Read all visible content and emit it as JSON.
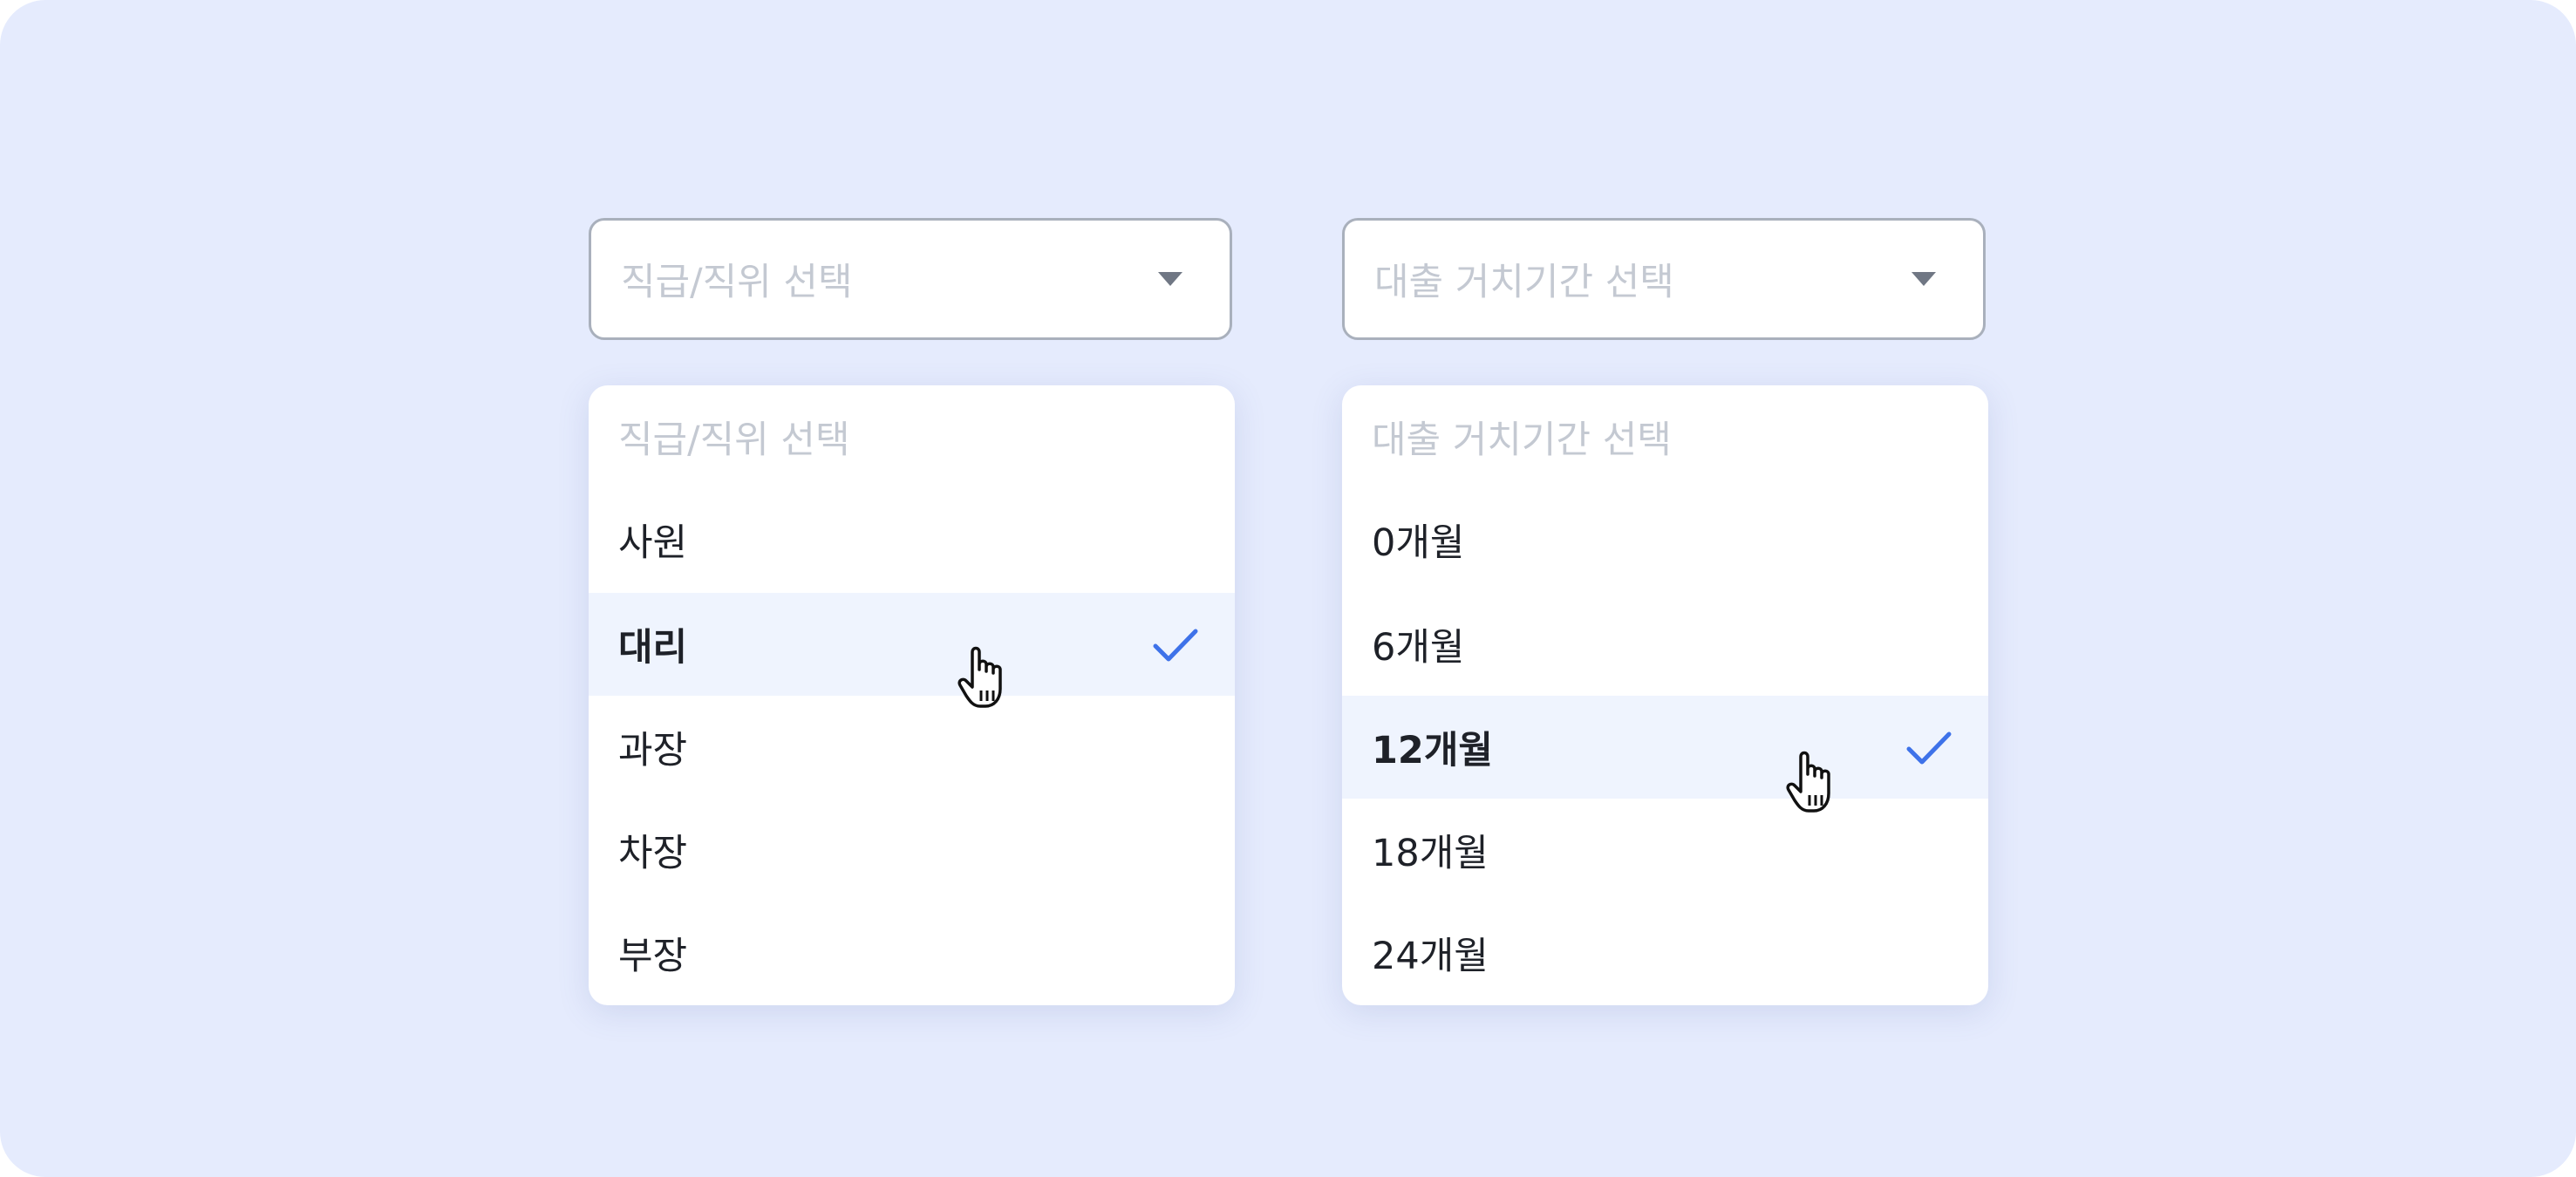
{
  "position_select": {
    "placeholder": "직급/직위 선택",
    "menu_header": "직급/직위 선택",
    "options": [
      "사원",
      "대리",
      "과장",
      "차장",
      "부장"
    ],
    "selected": "대리"
  },
  "grace_period_select": {
    "placeholder": "대출 거치기간 선택",
    "menu_header": "대출 거치기간 선택",
    "options": [
      "0개월",
      "6개월",
      "12개월",
      "18개월",
      "24개월"
    ],
    "selected": "12개월"
  },
  "icons": {
    "caret": "chevron-down-icon",
    "check": "check-icon",
    "cursor": "pointer-hand-icon"
  },
  "colors": {
    "background": "#e5ebfd",
    "selected_row": "#eff4fe",
    "check": "#3e72e9",
    "placeholder": "#c4c9d2",
    "text": "#1e2128"
  }
}
